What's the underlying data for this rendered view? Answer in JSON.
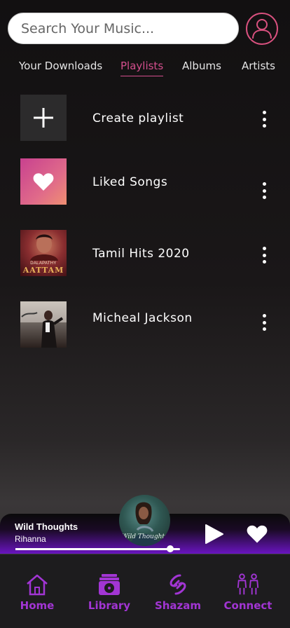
{
  "search": {
    "placeholder": "Search Your Music..."
  },
  "tabs": [
    {
      "label": "Your Downloads"
    },
    {
      "label": "Playlists",
      "active": true
    },
    {
      "label": "Albums"
    },
    {
      "label": "Artists"
    }
  ],
  "playlists": [
    {
      "title": "Create playlist",
      "thumb": "plus-icon"
    },
    {
      "title": "Liked Songs",
      "thumb": "heart-icon"
    },
    {
      "title": "Tamil Hits 2020",
      "thumb": "album-cover",
      "cover_text": "AATTAM",
      "cover_subtext": "DALAPATHY"
    },
    {
      "title": "Micheal Jackson",
      "thumb": "album-cover"
    }
  ],
  "now_playing": {
    "song": "Wild Thoughts",
    "artist": "Rihanna",
    "art_text": "Wild Thoughts",
    "progress": 0.94
  },
  "nav": [
    {
      "label": "Home",
      "icon": "home-icon"
    },
    {
      "label": "Library",
      "icon": "library-icon"
    },
    {
      "label": "Shazam",
      "icon": "shazam-icon"
    },
    {
      "label": "Connect",
      "icon": "connect-icon"
    }
  ],
  "colors": {
    "accent_pink": "#d44f8d",
    "accent_purple": "#a235d4",
    "background": "#121011"
  }
}
